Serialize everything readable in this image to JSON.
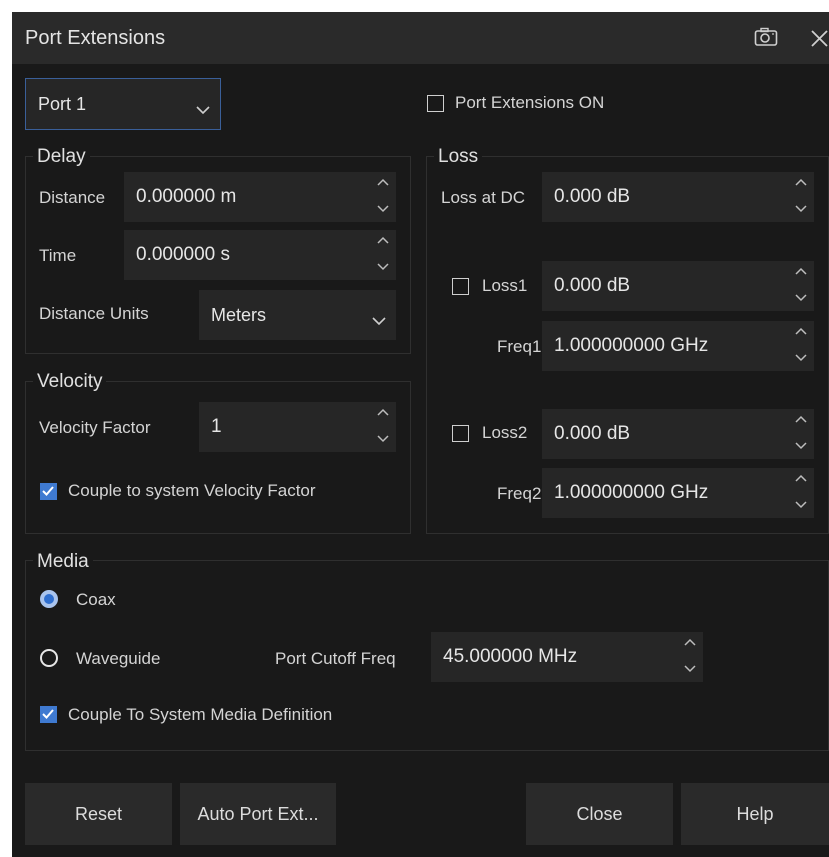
{
  "window": {
    "title": "Port Extensions"
  },
  "port_select": {
    "value": "Port 1"
  },
  "port_ext_on": {
    "label": "Port Extensions ON",
    "checked": false
  },
  "delay": {
    "title": "Delay",
    "distance_label": "Distance",
    "distance_value": "0.000000 m",
    "time_label": "Time",
    "time_value": "0.000000 s",
    "units_label": "Distance Units",
    "units_value": "Meters"
  },
  "velocity": {
    "title": "Velocity",
    "factor_label": "Velocity Factor",
    "factor_value": "1",
    "couple_label": "Couple to system Velocity Factor",
    "couple_checked": true
  },
  "loss": {
    "title": "Loss",
    "dc_label": "Loss at DC",
    "dc_value": "0.000 dB",
    "loss1_label": "Loss1",
    "loss1_value": "0.000 dB",
    "freq1_label": "Freq1",
    "freq1_value": "1.000000000 GHz",
    "loss2_label": "Loss2",
    "loss2_value": "0.000 dB",
    "freq2_label": "Freq2",
    "freq2_value": "1.000000000 GHz"
  },
  "media": {
    "title": "Media",
    "coax_label": "Coax",
    "waveguide_label": "Waveguide",
    "cutoff_label": "Port Cutoff Freq",
    "cutoff_value": "45.000000 MHz",
    "couple_label": "Couple To System Media Definition",
    "couple_checked": true
  },
  "buttons": {
    "reset": "Reset",
    "auto": "Auto Port Ext...",
    "close": "Close",
    "help": "Help"
  },
  "colors": {
    "accent": "#3f7ad1",
    "background": "#191919",
    "field": "#262626"
  }
}
